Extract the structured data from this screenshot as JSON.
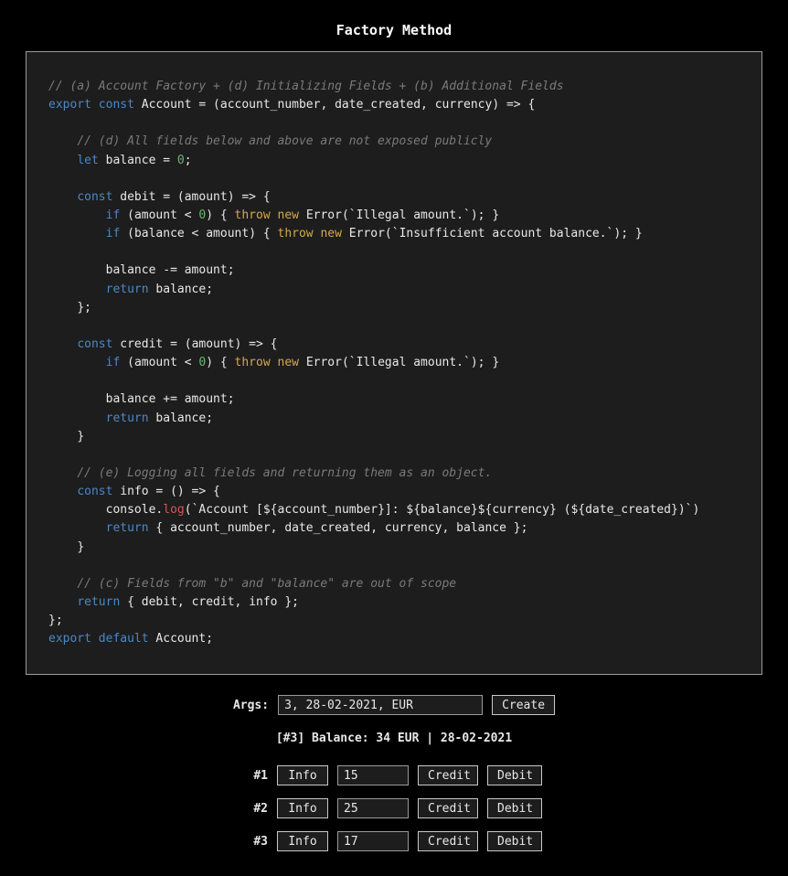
{
  "title": "Factory Method",
  "code": {
    "c_a": "// (a) Account Factory + (d) Initializing Fields + (b) Additional Fields",
    "c_d": "// (d) All fields below and above are not exposed publicly",
    "c_e": "// (e) Logging all fields and returning them as an object.",
    "c_c": "// (c) Fields from \"b\" and \"balance\" are out of scope",
    "kw_export": "export",
    "kw_const": "const",
    "kw_let": "let",
    "kw_if": "if",
    "kw_return": "return",
    "kw_throw": "throw",
    "kw_new": "new",
    "kw_default": "default",
    "id_Account": "Account",
    "id_account_number": "account_number",
    "id_date_created": "date_created",
    "id_currency": "currency",
    "id_balance": "balance",
    "id_amount": "amount",
    "id_debit": "debit",
    "id_credit": "credit",
    "id_info": "info",
    "id_Error": "Error",
    "id_console": "console",
    "id_log": "log",
    "num_zero": "0",
    "str_illegal": "`Illegal amount.`",
    "str_insufficient": "`Insufficient account balance.`",
    "tmpl_log_a": "`Account [",
    "tmpl_log_b": "]: ",
    "tmpl_log_c": " (",
    "tmpl_log_d": ")`",
    "sig_open": " = (",
    "sig_mid": ", ",
    "sig_close_arrow": ") => {",
    "close_brace_semi": "};",
    "close_brace": "}",
    "punct_semi": ";",
    "op_assign_zero": " = ",
    "op_lt": " < ",
    "op_minus_eq": " -= ",
    "op_plus_eq": " += ",
    "p_open": "(",
    "p_close": ") { ",
    "p_close2": "); }",
    "dot": ".",
    "dollar_open": "${",
    "dollar_close": "}",
    "ret_obj_open": " { ",
    "ret_obj_close": " };"
  },
  "controls": {
    "args_label": "Args:",
    "args_value": "3, 28-02-2021, EUR",
    "create_label": "Create",
    "status": "[#3] Balance: 34 EUR | 28-02-2021",
    "info_label": "Info",
    "credit_label": "Credit",
    "debit_label": "Debit",
    "rows": [
      {
        "idx": "#1",
        "amount": "15"
      },
      {
        "idx": "#2",
        "amount": "25"
      },
      {
        "idx": "#3",
        "amount": "17"
      }
    ]
  }
}
